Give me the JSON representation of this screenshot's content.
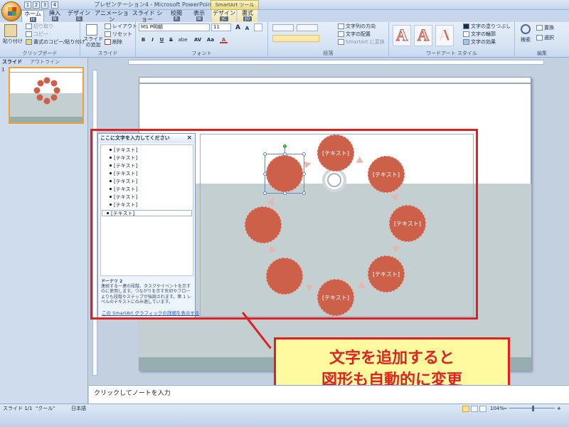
{
  "window": {
    "title": "プレゼンテーション4 - Microsoft PowerPoint",
    "context_tools": "SmartArt ツール",
    "quick_access": [
      "1",
      "2",
      "3",
      "4"
    ]
  },
  "ribbon": {
    "tabs": [
      {
        "label": "ホーム",
        "key": "H"
      },
      {
        "label": "挿入",
        "key": "N"
      },
      {
        "label": "デザイン",
        "key": "G"
      },
      {
        "label": "アニメーション",
        "key": "K"
      },
      {
        "label": "スライド ショー",
        "key": "S"
      },
      {
        "label": "校閲",
        "key": "R"
      },
      {
        "label": "表示",
        "key": "W"
      },
      {
        "label": "デザイン",
        "key": "JC"
      },
      {
        "label": "書式",
        "key": "JO"
      }
    ],
    "clipboard": {
      "paste": "貼り付け",
      "cut": "切り取り",
      "copy": "コピー",
      "format_painter": "書式のコピー/貼り付け",
      "label": "クリップボード"
    },
    "slides": {
      "new_slide": "スライド の追加",
      "layout": "レイアウト",
      "reset": "リセット",
      "delete": "削除",
      "label": "スライド"
    },
    "font": {
      "name": "MS P明朝",
      "size": "11",
      "grow": "A",
      "shrink": "A",
      "bold": "B",
      "italic": "I",
      "underline": "U",
      "strike": "S",
      "shadow": "abe",
      "spacing": "AV",
      "case": "Aa",
      "color": "A",
      "label": "フォント"
    },
    "paragraph": {
      "text_direction": "文字列の方向",
      "align_text": "文字の配置",
      "convert_smartart": "SmartArt に変換",
      "label": "段落"
    },
    "wordart": {
      "samples": [
        "A",
        "A",
        "A"
      ],
      "fill": "文字の塗りつぶし",
      "outline": "文字の輪郭",
      "effects": "文字の効果",
      "label": "ワードアート スタイル"
    },
    "editing": {
      "find": "検索",
      "replace": "置換",
      "select": "選択",
      "label": "編集"
    }
  },
  "left_panel": {
    "tabs": [
      "スライド",
      "アウトライン"
    ],
    "slide_number": "1"
  },
  "text_pane": {
    "title": "ここに文字を入力してください",
    "close": "×",
    "items": [
      "[テキスト]",
      "[テキスト]",
      "[テキスト]",
      "[テキスト]",
      "[テキスト]",
      "[テキスト]",
      "[テキスト]",
      "[テキスト]",
      "[テキスト]"
    ],
    "description_title": "ドーナツ 2",
    "description": "連続する一連の段階、タスクやイベントを示すのに使用します。つながりを示す矢印やフローよりも段階やステップが強調されます。第 1 レベルのテキストにのみ適しています。",
    "link": "この SmartArt グラフィックの詳細を表示する"
  },
  "smartart": {
    "nodes": [
      "[テキスト]",
      "[テキスト]",
      "[テキスト]",
      "[テキスト]",
      "[テキスト]"
    ],
    "node_color": "#cc6049",
    "arrow_color": "#eab5ab"
  },
  "callout": {
    "line1": "文字を追加すると",
    "line2": "図形も自動的に変更",
    "border_color": "#e32020",
    "fill_color": "#fff9a0"
  },
  "notes": {
    "placeholder": "クリックしてノートを入力"
  },
  "status": {
    "slide": "スライド 1/1",
    "theme": "\"クール\"",
    "language": "日本語",
    "zoom": "104%"
  }
}
